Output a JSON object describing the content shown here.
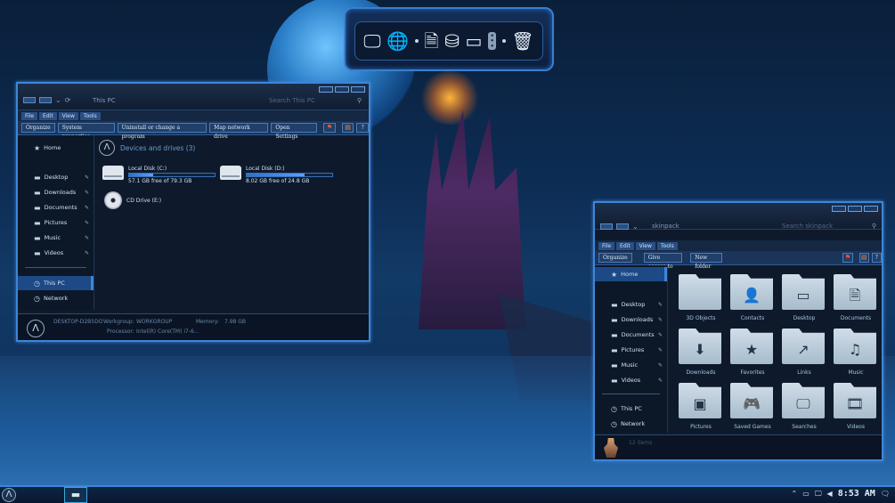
{
  "dock": {
    "icons": [
      "monitor-icon",
      "globe-network-icon",
      "document-icon",
      "drive-icon",
      "display-icon",
      "equalizer-icon",
      "trash-icon"
    ]
  },
  "thispc": {
    "address": "This PC",
    "search_placeholder": "Search This PC",
    "menu": [
      "File",
      "Edit",
      "View",
      "Tools"
    ],
    "commands": [
      "Organize",
      "System properties",
      "Uninstall or change a program",
      "Map network drive",
      "Open Settings"
    ],
    "sidebar": {
      "home": "Home",
      "quick": [
        {
          "label": "Desktop"
        },
        {
          "label": "Downloads"
        },
        {
          "label": "Documents"
        },
        {
          "label": "Pictures"
        },
        {
          "label": "Music"
        },
        {
          "label": "Videos"
        }
      ],
      "thispc": "This PC",
      "network": "Network"
    },
    "section_title": "Devices and drives (3)",
    "drives": [
      {
        "name": "Local Disk (C:)",
        "free": "57.1 GB free of 79.3 GB",
        "used_fraction": 0.28
      },
      {
        "name": "Local Disk (D:)",
        "free": "8.02 GB free of 24.8 GB",
        "used_fraction": 0.68
      }
    ],
    "cd": {
      "name": "CD Drive (E:)"
    },
    "status": {
      "pc_name": "DESKTOP-D2B5DO",
      "workgroup_label": "Workgroup:",
      "workgroup": "WORKGROUP",
      "memory_label": "Memory:",
      "memory": "7.98 GB",
      "processor_label": "Processor:",
      "processor": "Intel(R) Core(TM) i7-6..."
    }
  },
  "skinpack": {
    "address": "skinpack",
    "search_placeholder": "Search skinpack",
    "menu": [
      "File",
      "Edit",
      "View",
      "Tools"
    ],
    "commands": [
      "Organize",
      "Give access to",
      "New folder"
    ],
    "sidebar": {
      "home": "Home",
      "quick": [
        {
          "label": "Desktop"
        },
        {
          "label": "Downloads"
        },
        {
          "label": "Documents"
        },
        {
          "label": "Pictures"
        },
        {
          "label": "Music"
        },
        {
          "label": "Videos"
        }
      ],
      "thispc": "This PC",
      "network": "Network"
    },
    "folders": [
      {
        "label": "3D Objects",
        "icon": ""
      },
      {
        "label": "Contacts",
        "icon": "👤"
      },
      {
        "label": "Desktop",
        "icon": "▭"
      },
      {
        "label": "Documents",
        "icon": "🗎"
      },
      {
        "label": "Downloads",
        "icon": "⬇"
      },
      {
        "label": "Favorites",
        "icon": "★"
      },
      {
        "label": "Links",
        "icon": "↗"
      },
      {
        "label": "Music",
        "icon": "♫"
      },
      {
        "label": "Pictures",
        "icon": "▣"
      },
      {
        "label": "Saved Games",
        "icon": "🎮"
      },
      {
        "label": "Searches",
        "icon": "🖵"
      },
      {
        "label": "Videos",
        "icon": "🎞"
      }
    ],
    "status": {
      "items": "12 items"
    }
  },
  "taskbar": {
    "clock": "8:53 AM"
  }
}
